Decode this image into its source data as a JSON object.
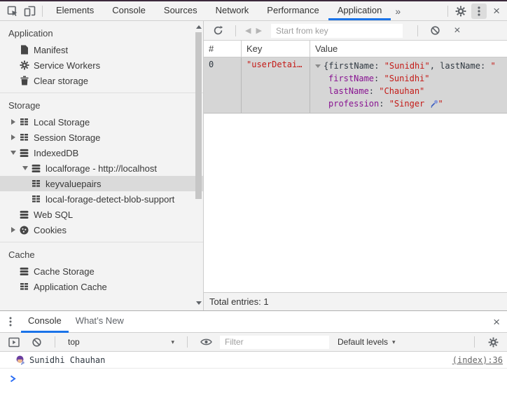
{
  "devtools": {
    "tabs": [
      "Elements",
      "Console",
      "Sources",
      "Network",
      "Performance",
      "Application"
    ],
    "selected_tab": "Application",
    "more_tabs_symbol": "»"
  },
  "sidebar": {
    "sections": {
      "application": {
        "header": "Application",
        "items": [
          "Manifest",
          "Service Workers",
          "Clear storage"
        ]
      },
      "storage": {
        "header": "Storage",
        "items": [
          "Local Storage",
          "Session Storage",
          "IndexedDB",
          "localforage - http://localhost",
          "keyvaluepairs",
          "local-forage-detect-blob-support",
          "Web SQL",
          "Cookies"
        ]
      },
      "cache": {
        "header": "Cache",
        "items": [
          "Cache Storage",
          "Application Cache"
        ]
      }
    },
    "selected_item": "keyvaluepairs"
  },
  "idb": {
    "toolbar": {
      "start_from_key_placeholder": "Start from key"
    },
    "columns": {
      "num": "#",
      "key": "Key",
      "value": "Value"
    },
    "row": {
      "num": "0",
      "key": "\"userDetai…",
      "separator": ": ",
      "preview": {
        "p1": "{firstName: ",
        "s1": "\"Sunidhi\"",
        "p2": ", lastName: ",
        "s2": "\""
      },
      "props": [
        {
          "name": "firstName",
          "value": "\"Sunidhi\""
        },
        {
          "name": "lastName",
          "value": "\"Chauhan\""
        },
        {
          "name": "profession",
          "value_prefix": "\"Singer ",
          "emoji": "🎤",
          "value_suffix": "\""
        }
      ]
    },
    "footer": "Total entries: 1"
  },
  "console": {
    "tabs": {
      "console": "Console",
      "whats_new": "What’s New"
    },
    "toolbar": {
      "context": "top",
      "filter_placeholder": "Filter",
      "levels": "Default levels"
    },
    "log": {
      "emoji": "👩‍🎤",
      "message": "Sunidhi Chauhan",
      "source": "(index):36"
    }
  },
  "colors": {
    "accent": "#1a73e8",
    "string": "#c41a16",
    "property": "#881391",
    "selection": "#dadada"
  }
}
